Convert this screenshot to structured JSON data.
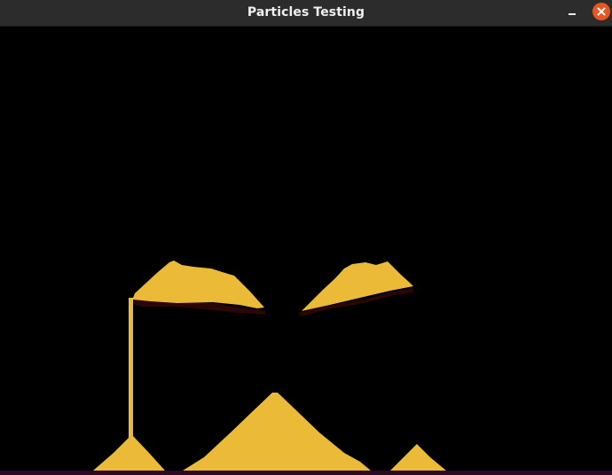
{
  "window": {
    "title": "Particles Testing",
    "controls": {
      "minimize_icon": "minimize-icon",
      "close_icon": "close-icon"
    }
  },
  "colors": {
    "titlebar": "#2c2c2c",
    "title_text": "#f0f0f0",
    "close_button": "#e95420",
    "sand": "#ebbb37",
    "shadow": "#2a0607",
    "ground": "#2c0a24",
    "background": "#000000"
  }
}
